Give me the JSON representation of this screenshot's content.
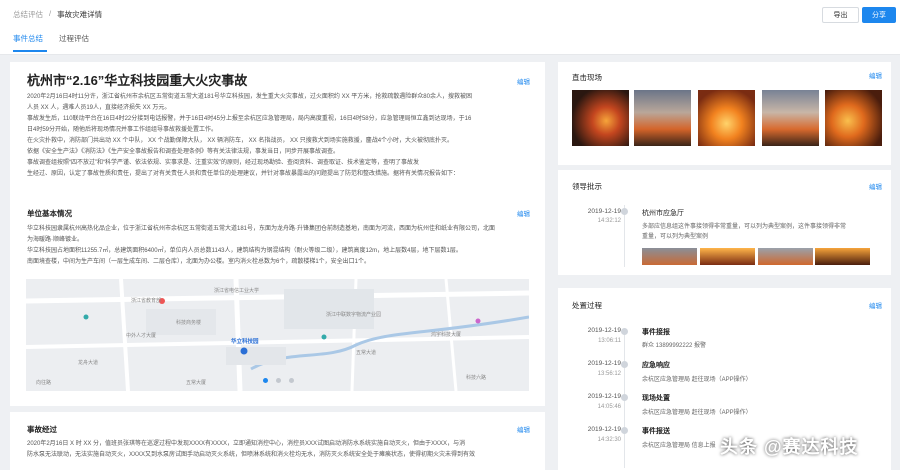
{
  "header": {
    "breadcrumb": [
      "总结评估",
      "/",
      "事故灾难详情"
    ],
    "export_label": "导出",
    "share_label": "分享",
    "tabs": [
      {
        "label": "事件总结",
        "active": true
      },
      {
        "label": "过程评估",
        "active": false
      }
    ]
  },
  "colors": {
    "accent": "#1d87ee",
    "highlight": "#e24b4b",
    "bg": "#eef0f3"
  },
  "summary": {
    "title": "杭州市“2.16”华立科技园重大火灾事故",
    "edit": "编辑",
    "paragraphs": [
      "2020年2月16日4时11分许，浙江省杭州市余杭区五常街道五常大道181号华立科技园，发生重大火灾事故，过火面积约 XX 平方米，抢救疏散遇险群众80余人，搜救被困",
      "人员 XX 人，遇难人员19人，直接经济损失 XX 万元。",
      "事故发生后，110联动平台在16日4时22分接到电话报警，并于16日4时45分上报至余杭区应急管理局，局内高度重视，16日4时58分，应急管理局恒立鑫到达现场，于16",
      "日4时59分开始，随他后将现场情况并事工作组组导事故救援处置工作。",
      "在火灾扑救中，消防部门共出动 XX 个中队， XX 个战勤保障大队， XX 辆消防车， XX 名指战员， XX 只搜救犬到场实施救援，鏖战4个小时，大火被彻底扑灭。",
      "依据《安全生产法》《消防法》《生产安全事故报告和调查处理条例》等有关法律法规，事发当日，同步开展事故调查。",
      "事故调查组按照“四不放过”和“科学严谨、依法依规、实事求是、注重实效”的原则，经过现场勘验、查阅资料、调查取证、技术鉴定等，查明了事故发",
      "生经过、原因，认定了事故性质和责任，提出了对有关责任人员和责任单位的处理建议，并针对事故暴露出的问题提出了防范和整改措施。据将有关情况报告如下："
    ]
  },
  "unit": {
    "title": "单位基本情况",
    "edit": "编辑",
    "paragraphs": [
      "华立科技园隶属杭州高热化品企业，位于浙江省杭州市余杭区五常街道五常大道181号，东面为龙舟路·升锋集团仓前制造基地，南面为河流，西面为杭州佳和纸业有限公司，北面",
      "为海暖路·顺峰镀业。",
      "华立科技园占地面积11255.7㎡，总建筑面积6400㎡，单位内人员总数1143人，建筑结构为钢混结构（耐火等级二级），建筑高度12m，地上层数4层，地下层数1层。",
      "南面境查楼，中间为生产车间（一层生成车间、二层仓库），北面为办公楼。室内消火栓总数为6个，疏散楼梯1个，安全出口1个。"
    ],
    "map_labels": [
      "浙江省教育部",
      "浙江省电信工业大学",
      "浙江中联数字物流产业园",
      "华立科技园",
      "中外人才大厦",
      "科技商务楼",
      "鸿宇科技大厦",
      "龙舟大道",
      "五常大道",
      "向往路",
      "科技六路",
      "五常大厦"
    ]
  },
  "process": {
    "title": "事故经过",
    "edit": "编辑",
    "paragraphs": [
      "2020年2月16日 X 时 XX 分，值班员张琪等在巡逻过程中发现XXXX有XXXX，立即通知消控中心，消控员XXX试图启动消防水系统实施自动灭火，但由于XXXX，与消",
      "防水泵无法联动，无法实施自动灭火，XXXX又到水泵房试图手动启动灭火系统，但喷淋系统和消火栓均无水，消防灭火系统安全处于瘫痪状态，使得初期火灾未得到有效"
    ]
  },
  "scene": {
    "title": "直击现场",
    "edit": "编辑"
  },
  "leader": {
    "title": "领导批示",
    "edit": "编辑",
    "entry": {
      "date": "2019-12-19",
      "time": "14:32:12",
      "org": "杭州市应急厅",
      "text": [
        "多部应信息组这件事接领得非常重量，可以列为典型案例，这件事接领得非常",
        "重量，可以列为典型案例"
      ]
    }
  },
  "handling": {
    "title": "处置过程",
    "edit": "编辑",
    "items": [
      {
        "date": "2019-12-19",
        "time": "13:06:11",
        "title": "事件接报",
        "detail": "群众 13899992222 报警"
      },
      {
        "date": "2019-12-19",
        "time": "13:56:12",
        "title": "应急响应",
        "detail": "余杭区应急管理局 赶往现场（APP操作）"
      },
      {
        "date": "2019-12-19",
        "time": "14:05:46",
        "title": "现场处置",
        "detail": "余杭区应急管理局 赶往现场（APP操作）"
      },
      {
        "date": "2019-12-19",
        "time": "14:32:30",
        "title": "事件报送",
        "detail": "余杭区应急管理局 信息上报"
      }
    ]
  },
  "watermark": "头条 @赛达科技"
}
